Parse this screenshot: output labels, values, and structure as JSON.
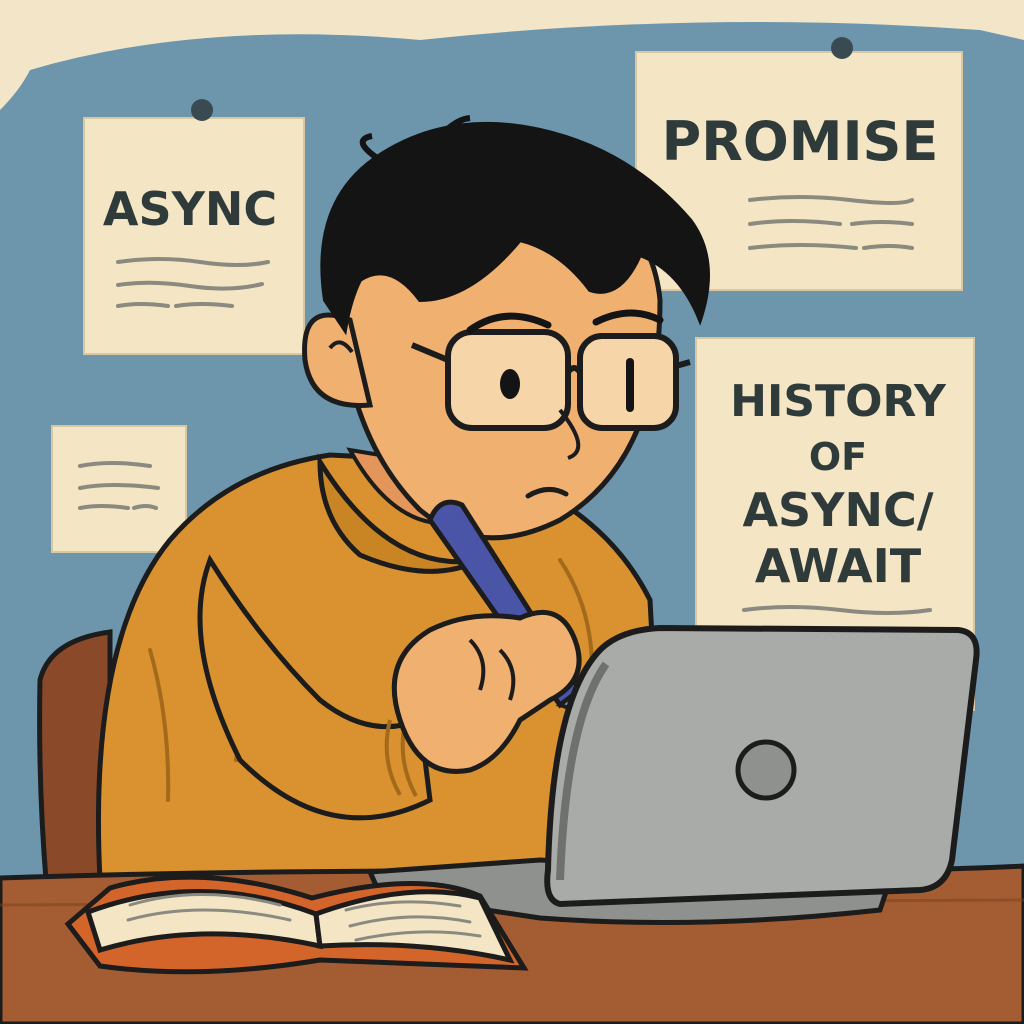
{
  "notes": {
    "async": {
      "title": "ASYNC"
    },
    "promise": {
      "title": "PROMISE"
    },
    "history": {
      "title_lines": [
        "HISTORY",
        "OF",
        "ASYNC/",
        "AWAIT"
      ]
    }
  },
  "colors": {
    "wall": "#6d96ad",
    "paper": "#f4e6c4",
    "sweater": "#d9922f",
    "skin": "#f0b070",
    "hair": "#141414",
    "desk": "#a45d32",
    "laptop": "#a9aba8",
    "pen": "#4a55a8",
    "book_cover": "#d4652a"
  },
  "icons": [
    "pushpin-icon",
    "laptop-logo-icon"
  ]
}
